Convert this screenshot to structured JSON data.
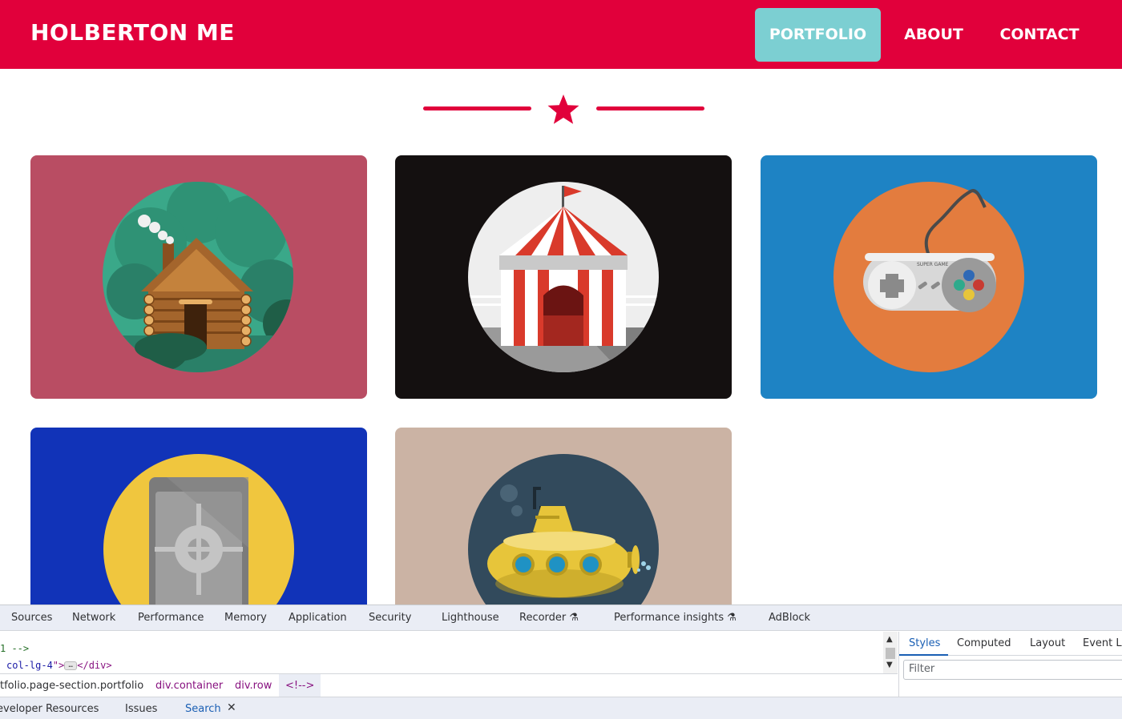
{
  "navbar": {
    "brand": "HOLBERTON ME",
    "links": [
      {
        "label": "PORTFOLIO",
        "active": true
      },
      {
        "label": "ABOUT",
        "active": false
      },
      {
        "label": "CONTACT",
        "active": false
      }
    ],
    "background_color": "#e1003b",
    "active_color": "#7ccfd2"
  },
  "divider": {
    "icon": "star-icon",
    "color": "#e1003b"
  },
  "portfolio": {
    "items": [
      {
        "icon": "cabin-icon",
        "background": "#b94d63"
      },
      {
        "icon": "circus-tent-icon",
        "background": "#141010"
      },
      {
        "icon": "game-controller-icon",
        "background": "#1e83c4",
        "controller_text": "SUPER GAME"
      },
      {
        "icon": "safe-icon",
        "background": "#1133b8"
      },
      {
        "icon": "submarine-icon",
        "background": "#cbb3a4"
      }
    ]
  },
  "devtools": {
    "tabs": [
      "Sources",
      "Network",
      "Performance",
      "Memory",
      "Application",
      "Security",
      "Lighthouse",
      "Recorder",
      "Performance insights",
      "AdBlock"
    ],
    "code_line1": "1 -->",
    "code_line2_attr": "col-lg-4",
    "code_line2_pre": " ",
    "code_line2_close": "</div>",
    "breadcrumbs": [
      "tfolio.page-section.portfolio",
      "div.container",
      "div.row",
      "<!-->"
    ],
    "side_tabs": [
      "Styles",
      "Computed",
      "Layout",
      "Event Li"
    ],
    "filter_placeholder": "Filter",
    "drawer_tabs": [
      "eveloper Resources",
      "Issues",
      "Search"
    ]
  }
}
